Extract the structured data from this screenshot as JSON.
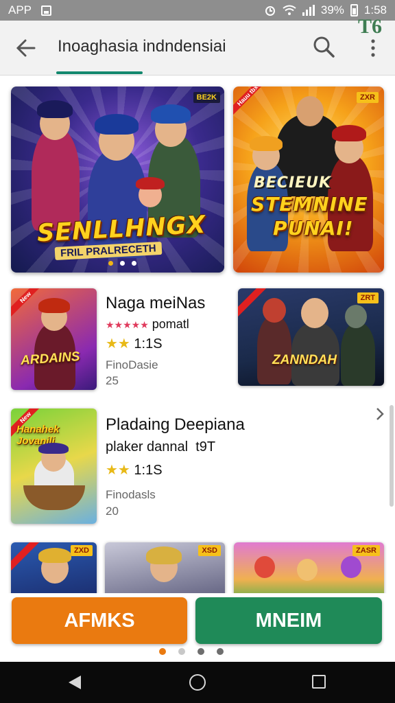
{
  "statusbar": {
    "app": "APP",
    "battery": "39%",
    "time": "1:58"
  },
  "appbar": {
    "title": "Inoaghasia indndensiai",
    "badge": "T6"
  },
  "banners": [
    {
      "logo": "SENLLHNGX",
      "subtitle": "FRIL PRALRECETH",
      "tag": "BE2K"
    },
    {
      "logo_line1": "BECIEUK",
      "logo_line2": "STEMNINE",
      "logo_line3": "PUNAI!",
      "tag": "ZXR",
      "ribbon": "Hauu tbx"
    }
  ],
  "games": [
    {
      "title": "Naga meiNas",
      "rating_text": "pomatl",
      "score": "1:1S",
      "category": "FinoDasie",
      "count": "25",
      "thumb_logo": "ARDAINS",
      "thumb_tag": "New",
      "side_logo": "ZANNDAH",
      "side_tag": "ZRT"
    },
    {
      "title": "Pladaing Deepiana",
      "subtitle": "plaker dannal  t9T",
      "score": "1:1S",
      "category": "Finodasls",
      "count": "20",
      "thumb_logo": "Hanahek Jovanili",
      "thumb_tag": "New"
    }
  ],
  "row3_tags": [
    "ZXD",
    "XSD",
    "ZASR"
  ],
  "buttons": {
    "left": "AFMKS",
    "right": "MNEIM"
  },
  "colors": {
    "accent": "#13886e",
    "primary_button": "#ea7a10",
    "secondary_button": "#1f8a58",
    "star": "#e8b917"
  }
}
